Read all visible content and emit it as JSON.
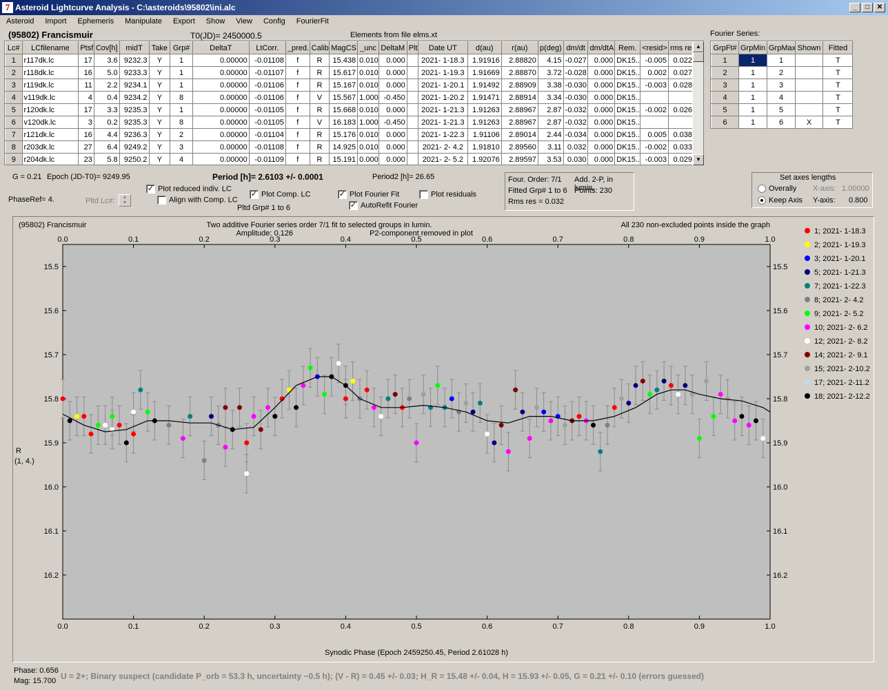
{
  "window": {
    "title": "Asteroid Lightcurve Analysis - C:\\asteroids\\95802\\ini.alc",
    "icon": "7"
  },
  "menu": [
    "Asteroid",
    "Import",
    "Ephemeris",
    "Manipulate",
    "Export",
    "Show",
    "View",
    "Config",
    "FourierFit"
  ],
  "header": {
    "object": "(95802) Francismuir",
    "t0": "T0(JD)= 2450000.5",
    "elements": "Elements from file elms.xt",
    "fourier_label": "Fourier Series:"
  },
  "lc_table": {
    "columns": [
      "Lc#",
      "LCfilename",
      "Ptsf",
      "Cov[h]",
      "midT",
      "Take",
      "Grp#",
      "DeltaT",
      "LtCorr.",
      "_pred.",
      "Calib.",
      "MagCS",
      "_unc",
      "DeltaM",
      "Plt",
      "Date UT",
      "d(au)",
      "r(au)",
      "p(deg)",
      "dm/dt",
      "dm/dtA",
      "Rem.",
      "<resid>",
      "rms res"
    ],
    "rows": [
      [
        "1",
        "r117dk.lc",
        "17",
        "3.6",
        "9232.3",
        "Y",
        "1",
        "0.00000",
        "-0.01108",
        "f",
        "R",
        "15.438",
        "0.010",
        "0.000",
        "",
        "2021- 1-18.3",
        "1.91916",
        "2.88820",
        "4.15",
        "-0.027",
        "0.000",
        "DK15...",
        "-0.005",
        "0.022"
      ],
      [
        "2",
        "r118dk.lc",
        "16",
        "5.0",
        "9233.3",
        "Y",
        "1",
        "0.00000",
        "-0.01107",
        "f",
        "R",
        "15.617",
        "0.010",
        "0.000",
        "",
        "2021- 1-19.3",
        "1.91669",
        "2.88870",
        "3.72",
        "-0.028",
        "0.000",
        "DK15...",
        "0.002",
        "0.027"
      ],
      [
        "3",
        "r119dk.lc",
        "11",
        "2.2",
        "9234.1",
        "Y",
        "1",
        "0.00000",
        "-0.01106",
        "f",
        "R",
        "15.167",
        "0.010",
        "0.000",
        "",
        "2021- 1-20.1",
        "1.91492",
        "2.88909",
        "3.38",
        "-0.030",
        "0.000",
        "DK15...",
        "-0.003",
        "0.028"
      ],
      [
        "4",
        "v119dk.lc",
        "4",
        "0.4",
        "9234.2",
        "Y",
        "8",
        "0.00000",
        "-0.01106",
        "f",
        "V",
        "15.567",
        "1.000",
        "-0.450",
        "",
        "2021- 1-20.2",
        "1.91471",
        "2.88914",
        "3.34",
        "-0.030",
        "0.000",
        "DK15...",
        "",
        ""
      ],
      [
        "5",
        "r120dk.lc",
        "17",
        "3.3",
        "9235.3",
        "Y",
        "1",
        "0.00000",
        "-0.01105",
        "f",
        "R",
        "15.668",
        "0.010",
        "0.000",
        "",
        "2021- 1-21.3",
        "1.91263",
        "2.88967",
        "2.87",
        "-0.032",
        "0.000",
        "DK15...",
        "-0.002",
        "0.026"
      ],
      [
        "6",
        "v120dk.lc",
        "3",
        "0.2",
        "9235.3",
        "Y",
        "8",
        "0.00000",
        "-0.01105",
        "f",
        "V",
        "16.183",
        "1.000",
        "-0.450",
        "",
        "2021- 1-21.3",
        "1.91263",
        "2.88967",
        "2.87",
        "-0.032",
        "0.000",
        "DK15...",
        "",
        ""
      ],
      [
        "7",
        "r121dk.lc",
        "16",
        "4.4",
        "9236.3",
        "Y",
        "2",
        "0.00000",
        "-0.01104",
        "f",
        "R",
        "15.176",
        "0.010",
        "0.000",
        "",
        "2021- 1-22.3",
        "1.91106",
        "2.89014",
        "2.44",
        "-0.034",
        "0.000",
        "DK15...",
        "0.005",
        "0.038"
      ],
      [
        "8",
        "r203dk.lc",
        "27",
        "6.4",
        "9249.2",
        "Y",
        "3",
        "0.00000",
        "-0.01108",
        "f",
        "R",
        "14.925",
        "0.010",
        "0.000",
        "",
        "2021- 2- 4.2",
        "1.91810",
        "2.89560",
        "3.11",
        "0.032",
        "0.000",
        "DK15...",
        "-0.002",
        "0.033"
      ],
      [
        "9",
        "r204dk.lc",
        "23",
        "5.8",
        "9250.2",
        "Y",
        "4",
        "0.00000",
        "-0.01109",
        "f",
        "R",
        "15.191",
        "0.000",
        "0.000",
        "",
        "2021- 2- 5.2",
        "1.92076",
        "2.89597",
        "3.53",
        "0.030",
        "0.000",
        "DK15...",
        "-0.003",
        "0.029"
      ]
    ]
  },
  "fourier_table": {
    "columns": [
      "GrpFt#",
      "GrpMin",
      "GrpMax",
      "Shown",
      "Fitted"
    ],
    "rows": [
      [
        "1",
        "1",
        "1",
        "",
        "T"
      ],
      [
        "2",
        "1",
        "2",
        "",
        "T"
      ],
      [
        "3",
        "1",
        "3",
        "",
        "T"
      ],
      [
        "4",
        "1",
        "4",
        "",
        "T"
      ],
      [
        "5",
        "1",
        "5",
        "",
        "T"
      ],
      [
        "6",
        "1",
        "6",
        "X",
        "T"
      ]
    ]
  },
  "info": {
    "g": "G = 0.21",
    "epoch": "Epoch (JD-T0)= 9249.95",
    "period": "Period [h]= 2.6103 +/- 0.0001",
    "period2": "Period2 [h]= 26.65",
    "phaseref": "PhaseRef= 4.",
    "pltd_lc": "Pltd Lc#:",
    "pltd_grp": "Pltd Grp#  1   to   6"
  },
  "checks": {
    "plot_reduced": {
      "label": "Plot reduced indiv. LC",
      "checked": true
    },
    "align": {
      "label": "Align with Comp. LC",
      "checked": false
    },
    "plot_comp": {
      "label": "Plot Comp. LC",
      "checked": true
    },
    "plot_fourier": {
      "label": "Plot Fourier Fit",
      "checked": true
    },
    "autorefit": {
      "label": "AutoRefit Fourier",
      "checked": true
    },
    "plot_resid": {
      "label": "Plot residuals",
      "checked": false
    }
  },
  "fourier_info": {
    "order": "Four. Order:  7/1",
    "add": "Add. 2-P, in lumin.",
    "fitted": "Fitted Grp# 1 to 6",
    "points": "Points: 230",
    "rms": "Rms res      = 0.032"
  },
  "axes_box": {
    "title": "Set axes lengths",
    "overally": "Overally",
    "keep": "Keep Axis",
    "xlabel": "X-axis:",
    "xval": "1.00000",
    "ylabel": "Y-axis:",
    "yval": "0.800"
  },
  "plot": {
    "name": "(95802) Francismuir",
    "line1": "Two additive Fourier series order 7/1 fit to selected groups in lumin.",
    "amp": "Amplitude: 0.126",
    "p2": "P2-component removed in plot",
    "allpts": "All 230 non-excluded points inside the graph",
    "ylabel1": "R",
    "ylabel2": "(1, 4.)",
    "xlabel": "Synodic Phase (Epoch 2459250.45, Period 2.61028 h)"
  },
  "chart_data": {
    "type": "scatter",
    "xlim": [
      0,
      1
    ],
    "ylim": [
      16.3,
      15.45
    ],
    "xticks": [
      "0.0",
      "0.1",
      "0.2",
      "0.3",
      "0.4",
      "0.5",
      "0.6",
      "0.7",
      "0.8",
      "0.9",
      "1.0"
    ],
    "yticks": [
      "15.5",
      "15.6",
      "15.7",
      "15.8",
      "15.9",
      "16.0",
      "16.1",
      "16.2"
    ],
    "legend": [
      {
        "label": "1; 2021- 1-18.3",
        "color": "#ff0000"
      },
      {
        "label": "2; 2021- 1-19.3",
        "color": "#ffff00"
      },
      {
        "label": "3; 2021- 1-20.1",
        "color": "#0000ff"
      },
      {
        "label": "5; 2021- 1-21.3",
        "color": "#000080"
      },
      {
        "label": "7; 2021- 1-22.3",
        "color": "#008080"
      },
      {
        "label": "8; 2021- 2- 4.2",
        "color": "#808080"
      },
      {
        "label": "9; 2021- 2- 5.2",
        "color": "#00ff00"
      },
      {
        "label": "10; 2021- 2- 6.2",
        "color": "#ff00ff"
      },
      {
        "label": "12; 2021- 2- 8.2",
        "color": "#ffffff"
      },
      {
        "label": "14; 2021- 2- 9.1",
        "color": "#800000"
      },
      {
        "label": "15; 2021- 2-10.2",
        "color": "#a0a0a0"
      },
      {
        "label": "17; 2021- 2-11.2",
        "color": "#c0d8f0"
      },
      {
        "label": "18; 2021- 2-12.2",
        "color": "#000000"
      }
    ],
    "fit_curve": {
      "x": [
        0,
        0.03,
        0.06,
        0.09,
        0.12,
        0.15,
        0.18,
        0.21,
        0.24,
        0.27,
        0.3,
        0.33,
        0.36,
        0.38,
        0.4,
        0.42,
        0.45,
        0.48,
        0.51,
        0.54,
        0.57,
        0.6,
        0.63,
        0.66,
        0.69,
        0.72,
        0.75,
        0.78,
        0.81,
        0.84,
        0.86,
        0.88,
        0.9,
        0.93,
        0.96,
        0.99,
        1.0
      ],
      "y": [
        15.835,
        15.86,
        15.875,
        15.87,
        15.85,
        15.85,
        15.855,
        15.855,
        15.87,
        15.865,
        15.82,
        15.77,
        15.75,
        15.75,
        15.77,
        15.8,
        15.82,
        15.82,
        15.815,
        15.82,
        15.83,
        15.85,
        15.855,
        15.84,
        15.84,
        15.85,
        15.85,
        15.84,
        15.82,
        15.79,
        15.78,
        15.78,
        15.79,
        15.8,
        15.805,
        15.82,
        15.83
      ]
    },
    "points": [
      {
        "x": 0.0,
        "y": 15.8,
        "g": 0
      },
      {
        "x": 0.01,
        "y": 15.85,
        "g": 12
      },
      {
        "x": 0.02,
        "y": 15.84,
        "g": 1
      },
      {
        "x": 0.03,
        "y": 15.84,
        "g": 0
      },
      {
        "x": 0.04,
        "y": 15.88,
        "g": 0
      },
      {
        "x": 0.05,
        "y": 15.86,
        "g": 6
      },
      {
        "x": 0.06,
        "y": 15.86,
        "g": 8
      },
      {
        "x": 0.07,
        "y": 15.84,
        "g": 6
      },
      {
        "x": 0.07,
        "y": 15.87,
        "g": 8
      },
      {
        "x": 0.08,
        "y": 15.86,
        "g": 0
      },
      {
        "x": 0.09,
        "y": 15.9,
        "g": 12
      },
      {
        "x": 0.1,
        "y": 15.83,
        "g": 8
      },
      {
        "x": 0.1,
        "y": 15.88,
        "g": 0
      },
      {
        "x": 0.11,
        "y": 15.78,
        "g": 4
      },
      {
        "x": 0.12,
        "y": 15.83,
        "g": 6
      },
      {
        "x": 0.13,
        "y": 15.85,
        "g": 12
      },
      {
        "x": 0.15,
        "y": 15.86,
        "g": 5
      },
      {
        "x": 0.17,
        "y": 15.89,
        "g": 7
      },
      {
        "x": 0.18,
        "y": 15.84,
        "g": 4
      },
      {
        "x": 0.2,
        "y": 15.94,
        "g": 5
      },
      {
        "x": 0.21,
        "y": 15.84,
        "g": 3
      },
      {
        "x": 0.22,
        "y": 15.86,
        "g": 5
      },
      {
        "x": 0.23,
        "y": 15.82,
        "g": 9
      },
      {
        "x": 0.23,
        "y": 15.91,
        "g": 7
      },
      {
        "x": 0.24,
        "y": 15.87,
        "g": 12
      },
      {
        "x": 0.25,
        "y": 15.82,
        "g": 9
      },
      {
        "x": 0.26,
        "y": 15.9,
        "g": 0
      },
      {
        "x": 0.26,
        "y": 15.97,
        "g": 8
      },
      {
        "x": 0.27,
        "y": 15.84,
        "g": 7
      },
      {
        "x": 0.28,
        "y": 15.87,
        "g": 9
      },
      {
        "x": 0.29,
        "y": 15.82,
        "g": 7
      },
      {
        "x": 0.3,
        "y": 15.84,
        "g": 12
      },
      {
        "x": 0.31,
        "y": 15.8,
        "g": 0
      },
      {
        "x": 0.32,
        "y": 15.78,
        "g": 1
      },
      {
        "x": 0.33,
        "y": 15.82,
        "g": 12
      },
      {
        "x": 0.34,
        "y": 15.77,
        "g": 7
      },
      {
        "x": 0.35,
        "y": 15.73,
        "g": 6
      },
      {
        "x": 0.36,
        "y": 15.75,
        "g": 2
      },
      {
        "x": 0.37,
        "y": 15.79,
        "g": 6
      },
      {
        "x": 0.38,
        "y": 15.75,
        "g": 12
      },
      {
        "x": 0.39,
        "y": 15.72,
        "g": 8
      },
      {
        "x": 0.4,
        "y": 15.8,
        "g": 0
      },
      {
        "x": 0.4,
        "y": 15.77,
        "g": 12
      },
      {
        "x": 0.41,
        "y": 15.76,
        "g": 1
      },
      {
        "x": 0.42,
        "y": 15.8,
        "g": 5
      },
      {
        "x": 0.43,
        "y": 15.78,
        "g": 0
      },
      {
        "x": 0.44,
        "y": 15.82,
        "g": 7
      },
      {
        "x": 0.45,
        "y": 15.84,
        "g": 8
      },
      {
        "x": 0.46,
        "y": 15.8,
        "g": 4
      },
      {
        "x": 0.47,
        "y": 15.79,
        "g": 9
      },
      {
        "x": 0.48,
        "y": 15.82,
        "g": 0
      },
      {
        "x": 0.49,
        "y": 15.8,
        "g": 5
      },
      {
        "x": 0.5,
        "y": 15.9,
        "g": 7
      },
      {
        "x": 0.51,
        "y": 15.79,
        "g": 10
      },
      {
        "x": 0.52,
        "y": 15.82,
        "g": 4
      },
      {
        "x": 0.53,
        "y": 15.77,
        "g": 6
      },
      {
        "x": 0.54,
        "y": 15.82,
        "g": 4
      },
      {
        "x": 0.55,
        "y": 15.8,
        "g": 2
      },
      {
        "x": 0.56,
        "y": 15.83,
        "g": 5
      },
      {
        "x": 0.57,
        "y": 15.81,
        "g": 10
      },
      {
        "x": 0.58,
        "y": 15.83,
        "g": 3
      },
      {
        "x": 0.59,
        "y": 15.81,
        "g": 4
      },
      {
        "x": 0.6,
        "y": 15.88,
        "g": 8
      },
      {
        "x": 0.61,
        "y": 15.9,
        "g": 3
      },
      {
        "x": 0.62,
        "y": 15.86,
        "g": 9
      },
      {
        "x": 0.63,
        "y": 15.92,
        "g": 7
      },
      {
        "x": 0.64,
        "y": 15.78,
        "g": 9
      },
      {
        "x": 0.65,
        "y": 15.83,
        "g": 3
      },
      {
        "x": 0.66,
        "y": 15.89,
        "g": 7
      },
      {
        "x": 0.67,
        "y": 15.82,
        "g": 10
      },
      {
        "x": 0.68,
        "y": 15.83,
        "g": 2
      },
      {
        "x": 0.69,
        "y": 15.85,
        "g": 7
      },
      {
        "x": 0.7,
        "y": 15.84,
        "g": 2
      },
      {
        "x": 0.71,
        "y": 15.86,
        "g": 10
      },
      {
        "x": 0.72,
        "y": 15.85,
        "g": 9
      },
      {
        "x": 0.73,
        "y": 15.84,
        "g": 0
      },
      {
        "x": 0.74,
        "y": 15.85,
        "g": 7
      },
      {
        "x": 0.75,
        "y": 15.86,
        "g": 12
      },
      {
        "x": 0.76,
        "y": 15.92,
        "g": 4
      },
      {
        "x": 0.77,
        "y": 15.86,
        "g": 5
      },
      {
        "x": 0.78,
        "y": 15.82,
        "g": 0
      },
      {
        "x": 0.79,
        "y": 15.8,
        "g": 10
      },
      {
        "x": 0.8,
        "y": 15.81,
        "g": 3
      },
      {
        "x": 0.81,
        "y": 15.77,
        "g": 3
      },
      {
        "x": 0.82,
        "y": 15.76,
        "g": 9
      },
      {
        "x": 0.83,
        "y": 15.79,
        "g": 6
      },
      {
        "x": 0.84,
        "y": 15.78,
        "g": 4
      },
      {
        "x": 0.85,
        "y": 15.76,
        "g": 3
      },
      {
        "x": 0.86,
        "y": 15.77,
        "g": 0
      },
      {
        "x": 0.87,
        "y": 15.79,
        "g": 8
      },
      {
        "x": 0.88,
        "y": 15.77,
        "g": 3
      },
      {
        "x": 0.89,
        "y": 15.79,
        "g": 10
      },
      {
        "x": 0.9,
        "y": 15.89,
        "g": 6
      },
      {
        "x": 0.91,
        "y": 15.76,
        "g": 10
      },
      {
        "x": 0.92,
        "y": 15.84,
        "g": 6
      },
      {
        "x": 0.93,
        "y": 15.79,
        "g": 7
      },
      {
        "x": 0.94,
        "y": 15.8,
        "g": 10
      },
      {
        "x": 0.95,
        "y": 15.85,
        "g": 7
      },
      {
        "x": 0.96,
        "y": 15.84,
        "g": 12
      },
      {
        "x": 0.97,
        "y": 15.86,
        "g": 7
      },
      {
        "x": 0.98,
        "y": 15.85,
        "g": 12
      },
      {
        "x": 0.99,
        "y": 15.89,
        "g": 8
      }
    ]
  },
  "footer": {
    "phase": "Phase:  0.656",
    "mag": "Mag:   15.700",
    "status": "U = 2+; Binary suspect (candidate P_orb = 53.3 h, uncertainty ~0.5 h); (V - R) = 0.45 +/- 0.03; H_R = 15.48 +/- 0.04, H = 15.93 +/- 0.05, G = 0.21 +/- 0.10 (errors guessed)"
  }
}
